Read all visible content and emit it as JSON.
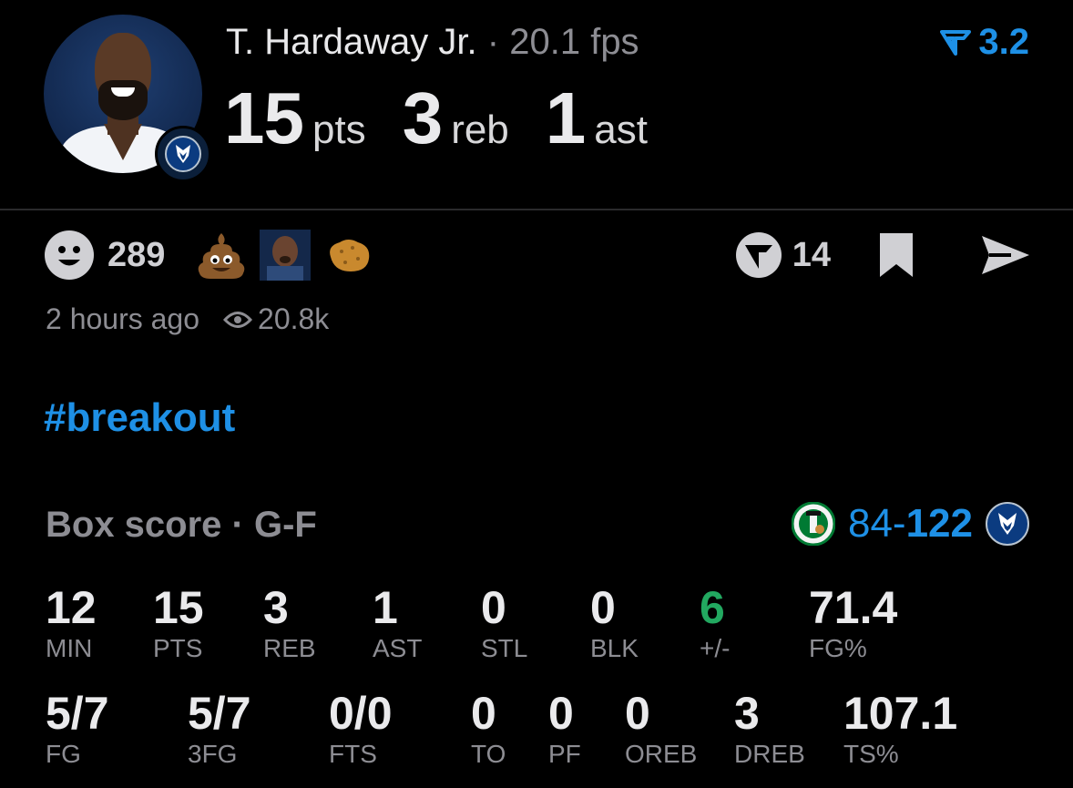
{
  "header": {
    "player_name": "T. Hardaway Jr.",
    "separator": "·",
    "fps": "20.1 fps",
    "rating": "3.2",
    "pts_value": "15",
    "pts_unit": "pts",
    "reb_value": "3",
    "reb_unit": "reb",
    "ast_value": "1",
    "ast_unit": "ast"
  },
  "reactions": {
    "smiley_count": "289",
    "emojis": [
      "poop-emoji",
      "player-face-emoji",
      "nugget-emoji"
    ],
    "comment_count": "14"
  },
  "meta": {
    "time": "2 hours ago",
    "views": "20.8k"
  },
  "hashtag": "#breakout",
  "box_score": {
    "title": "Box score · G-F",
    "score_away": "84",
    "score_dash": "-",
    "score_home": "122",
    "row1": [
      {
        "value": "12",
        "label": "MIN"
      },
      {
        "value": "15",
        "label": "PTS"
      },
      {
        "value": "3",
        "label": "REB"
      },
      {
        "value": "1",
        "label": "AST"
      },
      {
        "value": "0",
        "label": "STL"
      },
      {
        "value": "0",
        "label": "BLK"
      },
      {
        "value": "6",
        "label": "+/-"
      },
      {
        "value": "71.4",
        "label": "FG%"
      }
    ],
    "row2": [
      {
        "value": "5/7",
        "label": "FG"
      },
      {
        "value": "5/7",
        "label": "3FG"
      },
      {
        "value": "0/0",
        "label": "FTS"
      },
      {
        "value": "0",
        "label": "TO"
      },
      {
        "value": "0",
        "label": "PF"
      },
      {
        "value": "0",
        "label": "OREB"
      },
      {
        "value": "3",
        "label": "DREB"
      },
      {
        "value": "107.1",
        "label": "TS%"
      }
    ]
  },
  "colors": {
    "accent": "#1e90e6",
    "positive": "#22a860",
    "muted": "#8d8d93",
    "background": "#000000"
  }
}
